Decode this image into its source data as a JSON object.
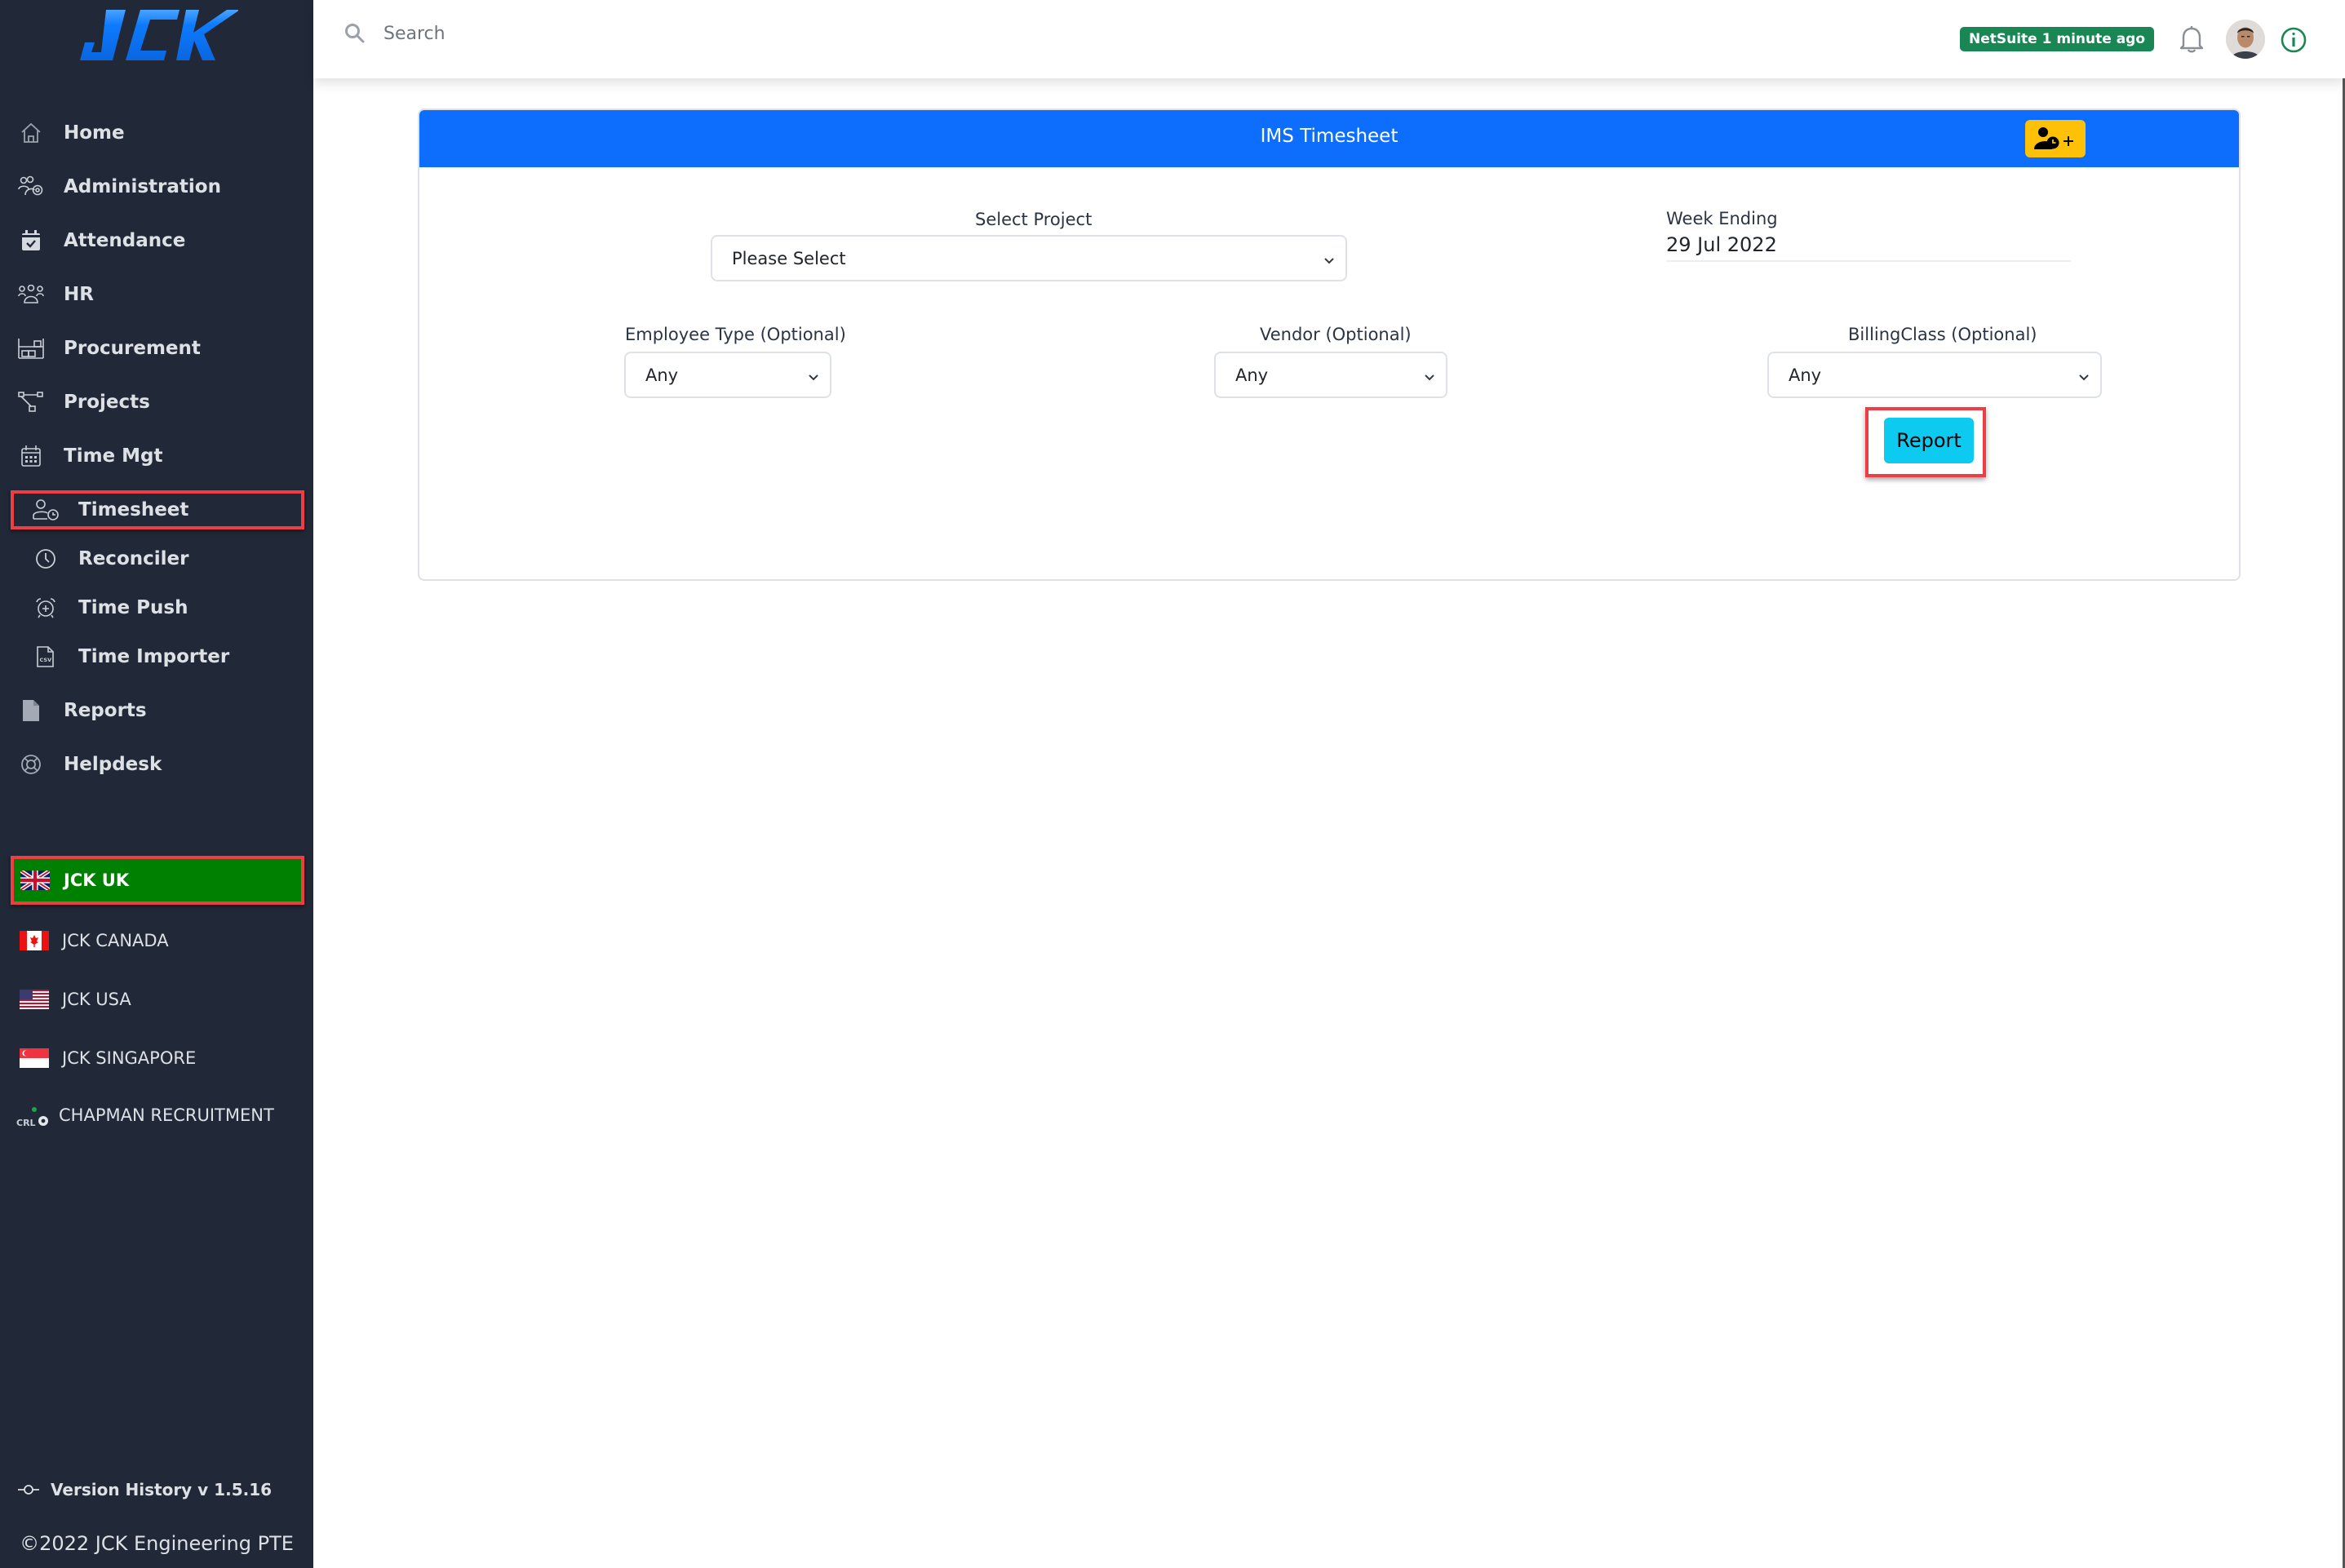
{
  "sidebar": {
    "logo_text": "JCK",
    "nav": [
      {
        "label": "Home",
        "icon": "home-icon"
      },
      {
        "label": "Administration",
        "icon": "users-gear-icon"
      },
      {
        "label": "Attendance",
        "icon": "calendar-check-icon"
      },
      {
        "label": "HR",
        "icon": "people-icon"
      },
      {
        "label": "Procurement",
        "icon": "warehouse-icon"
      },
      {
        "label": "Projects",
        "icon": "diagram-icon"
      },
      {
        "label": "Time Mgt",
        "icon": "calendar-icon"
      }
    ],
    "sub_nav": [
      {
        "label": "Timesheet",
        "icon": "user-clock-icon",
        "active": true
      },
      {
        "label": "Reconciler",
        "icon": "clock-icon"
      },
      {
        "label": "Time Push",
        "icon": "alarm-plus-icon"
      },
      {
        "label": "Time Importer",
        "icon": "csv-file-icon"
      }
    ],
    "nav_after": [
      {
        "label": "Reports",
        "icon": "file-icon"
      },
      {
        "label": "Helpdesk",
        "icon": "lifebuoy-icon"
      }
    ],
    "regions": [
      {
        "label": "JCK UK",
        "flag": "uk-flag-icon",
        "active": true
      },
      {
        "label": "JCK CANADA",
        "flag": "canada-flag-icon"
      },
      {
        "label": "JCK USA",
        "flag": "usa-flag-icon"
      },
      {
        "label": "JCK SINGAPORE",
        "flag": "singapore-flag-icon"
      },
      {
        "label": "CHAPMAN RECRUITMENT",
        "flag": "crl-logo-icon"
      }
    ],
    "version_label": "Version History v 1.5.16",
    "copyright": "©2022 JCK Engineering PTE"
  },
  "topbar": {
    "search_placeholder": "Search",
    "sync_badge": "NetSuite 1 minute ago",
    "colors": {
      "badge": "#198754",
      "info": "#198754"
    }
  },
  "card": {
    "title": "IMS Timesheet",
    "colors": {
      "header": "#0d6efd",
      "add_button": "#ffc107",
      "report_button": "#0dcaf0",
      "highlight": "#ee3e45",
      "active_region": "#008000"
    },
    "project": {
      "label": "Select Project",
      "value": "Please Select"
    },
    "week_ending": {
      "label": "Week Ending",
      "value": "29 Jul 2022"
    },
    "employee_type": {
      "label": "Employee Type (Optional)",
      "value": "Any"
    },
    "vendor": {
      "label": "Vendor (Optional)",
      "value": "Any"
    },
    "billing_class": {
      "label": "BillingClass (Optional)",
      "value": "Any"
    },
    "report_label": "Report"
  }
}
